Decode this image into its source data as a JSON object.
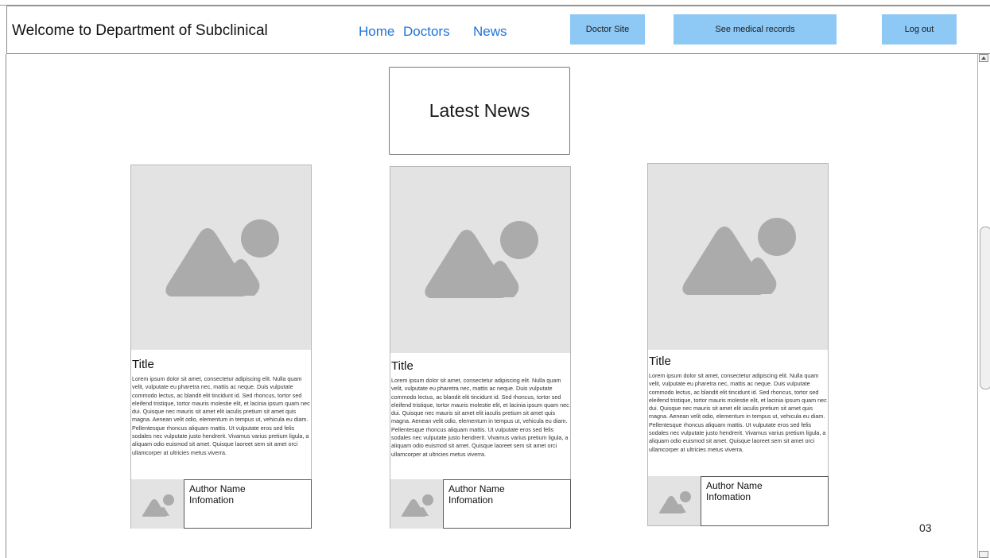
{
  "header": {
    "title": "Welcome to Department of Subclinical",
    "nav": [
      "Home",
      "Doctors",
      "News"
    ],
    "buttons": {
      "doctor_site": "Doctor Site",
      "medical_records": "See medical records",
      "logout": "Log out"
    }
  },
  "main": {
    "section_title": "Latest News",
    "cards": [
      {
        "title": "Title",
        "body": "Lorem ipsum dolor sit amet, consectetur adipiscing elit. Nulla quam velit, vulputate eu pharetra nec, mattis ac neque. Duis vulputate commodo lectus, ac blandit elit tincidunt id. Sed rhoncus, tortor sed eleifend tristique, tortor mauris molestie elit, et lacinia ipsum quam nec dui. Quisque nec mauris sit amet elit iaculis pretium sit amet quis magna. Aenean velit odio, elementum in tempus ut, vehicula eu diam. Pellentesque rhoncus aliquam mattis. Ut vulputate eros sed felis sodales nec vulputate justo hendrerit. Vivamus varius pretium ligula, a aliquam odio euismod sit amet. Quisque laoreet sem sit amet orci ullamcorper at ultricies metus viverra.",
        "author_name": "Author Name",
        "author_info": "Infomation"
      },
      {
        "title": "Title",
        "body": "Lorem ipsum dolor sit amet, consectetur adipiscing elit. Nulla quam velit, vulputate eu pharetra nec, mattis ac neque. Duis vulputate commodo lectus, ac blandit elit tincidunt id. Sed rhoncus, tortor sed eleifend tristique, tortor mauris molestie elit, et lacinia ipsum quam nec dui. Quisque nec mauris sit amet elit iaculis pretium sit amet quis magna. Aenean velit odio, elementum in tempus ut, vehicula eu diam. Pellentesque rhoncus aliquam mattis. Ut vulputate eros sed felis sodales nec vulputate justo hendrerit. Vivamus varius pretium ligula, a aliquam odio euismod sit amet. Quisque laoreet sem sit amet orci ullamcorper at ultricies metus viverra.",
        "author_name": "Author Name",
        "author_info": "Infomation"
      },
      {
        "title": "Title",
        "body": "Lorem ipsum dolor sit amet, consectetur adipiscing elit. Nulla quam velit, vulputate eu pharetra nec, mattis ac neque. Duis vulputate commodo lectus, ac blandit elit tincidunt id. Sed rhoncus, tortor sed eleifend tristique, tortor mauris molestie elit, et lacinia ipsum quam nec dui. Quisque nec mauris sit amet elit iaculis pretium sit amet quis magna. Aenean velit odio, elementum in tempus ut, vehicula eu diam. Pellentesque rhoncus aliquam mattis. Ut vulputate eros sed felis sodales nec vulputate justo hendrerit. Vivamus varius pretium ligula, a aliquam odio euismod sit amet. Quisque laoreet sem sit amet orci ullamcorper at ultricies metus viverra.",
        "author_name": "Author Name",
        "author_info": "Infomation"
      }
    ],
    "page_number": "03"
  },
  "icons": {
    "image_placeholder": "image-placeholder-icon",
    "scroll_up": "chevron-up-icon",
    "scroll_down": "chevron-down-icon"
  },
  "colors": {
    "nav_link": "#1f73d6",
    "button_bg": "#8ec8f5",
    "placeholder_bg": "#e3e3e3",
    "placeholder_icon": "#ababab"
  }
}
